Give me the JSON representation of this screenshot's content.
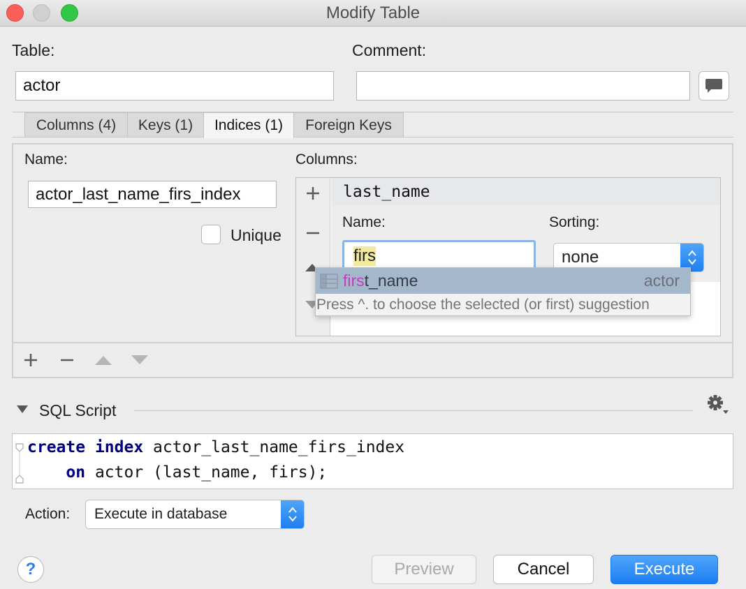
{
  "window": {
    "title": "Modify Table"
  },
  "table": {
    "label": "Table:",
    "value": "actor"
  },
  "comment": {
    "label": "Comment:",
    "value": ""
  },
  "tabs": [
    {
      "label": "Columns (4)"
    },
    {
      "label": "Keys (1)"
    },
    {
      "label": "Indices (1)"
    },
    {
      "label": "Foreign Keys"
    }
  ],
  "index": {
    "name_label": "Name:",
    "name_value": "actor_last_name_firs_index",
    "unique_label": "Unique",
    "unique_checked": false,
    "columns_label": "Columns:",
    "column_header": "last_name",
    "col_name_label": "Name:",
    "col_name_value": "firs",
    "sorting_label": "Sorting:",
    "sorting_value": "none"
  },
  "autocomplete": {
    "match": "firs",
    "rest": "t_name",
    "source": "actor",
    "hint": "Press ^. to choose the selected (or first) suggestion"
  },
  "sql": {
    "section_label": "SQL Script",
    "line1_kw1": "create",
    "line1_kw2": "index",
    "line1_rest": " actor_last_name_firs_index",
    "line2_kw": "on",
    "line2_rest": " actor (last_name, firs);"
  },
  "action": {
    "label": "Action:",
    "value": "Execute in database"
  },
  "buttons": {
    "help": "?",
    "preview": "Preview",
    "cancel": "Cancel",
    "execute": "Execute"
  },
  "colors": {
    "accent": "#1f7ff0",
    "match": "#c23fbf",
    "keyword": "#000080",
    "selection": "#a5b7ca"
  }
}
